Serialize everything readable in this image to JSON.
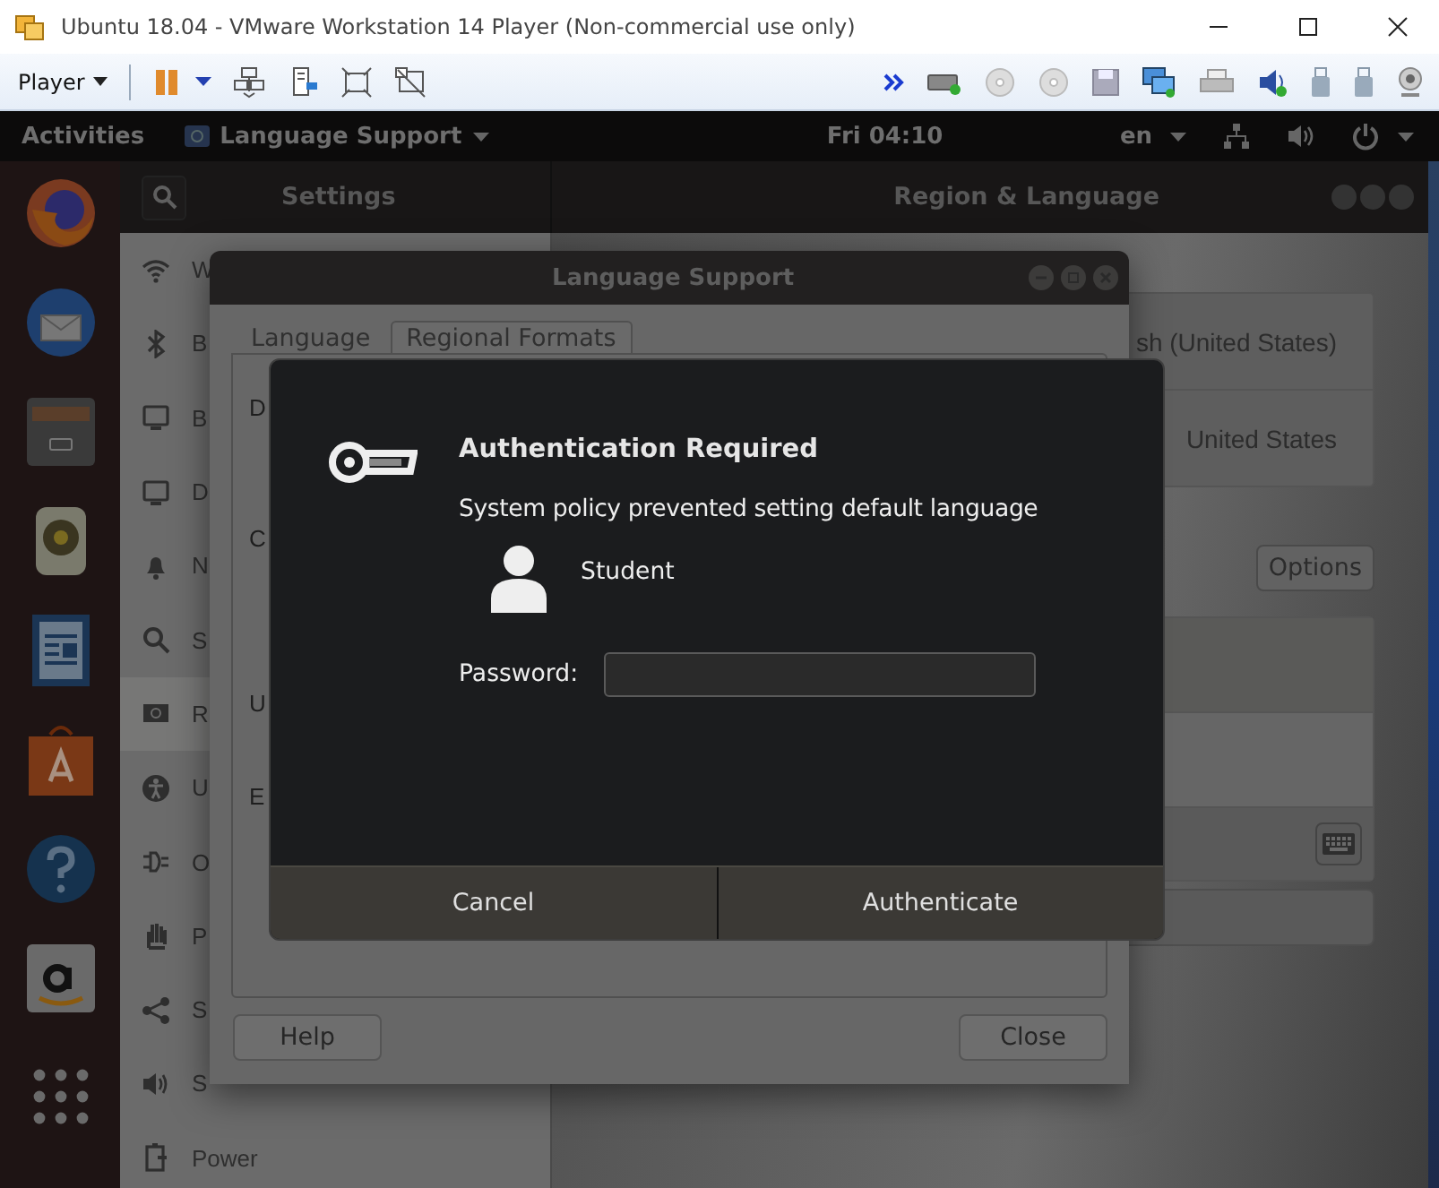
{
  "vm_window": {
    "title": "Ubuntu 18.04 - VMware Workstation 14 Player (Non-commercial use only)"
  },
  "vm_toolbar": {
    "player_menu": "Player"
  },
  "top_bar": {
    "activities": "Activities",
    "app_menu": "Language Support",
    "clock": "Fri 04:10",
    "input_source": "en"
  },
  "settings": {
    "title": "Settings",
    "panel_title": "Region & Language",
    "sidebar": [
      {
        "label": "W",
        "selected": false
      },
      {
        "label": "B",
        "selected": false
      },
      {
        "label": "B",
        "selected": false
      },
      {
        "label": "D",
        "selected": false
      },
      {
        "label": "N",
        "selected": false
      },
      {
        "label": "S",
        "selected": false
      },
      {
        "label": "R",
        "selected": true
      },
      {
        "label": "U",
        "selected": false
      },
      {
        "label": "O",
        "selected": false
      },
      {
        "label": "P",
        "selected": false
      },
      {
        "label": "S",
        "selected": false
      },
      {
        "label": "S",
        "selected": false
      },
      {
        "label": "Power",
        "selected": false
      }
    ],
    "language_row": "sh (United States)",
    "formats_row": "United States",
    "options_button": "Options"
  },
  "language_support": {
    "title": "Language Support",
    "tabs": [
      {
        "label": "Language",
        "selected": false
      },
      {
        "label": "Regional Formats",
        "selected": true
      }
    ],
    "fragments": [
      "D",
      "C",
      "U",
      "E"
    ],
    "help_button": "Help",
    "close_button": "Close"
  },
  "auth_dialog": {
    "title": "Authentication Required",
    "message": "System policy prevented setting default language",
    "user": "Student",
    "password_label": "Password:",
    "cancel_button": "Cancel",
    "authenticate_button": "Authenticate"
  }
}
